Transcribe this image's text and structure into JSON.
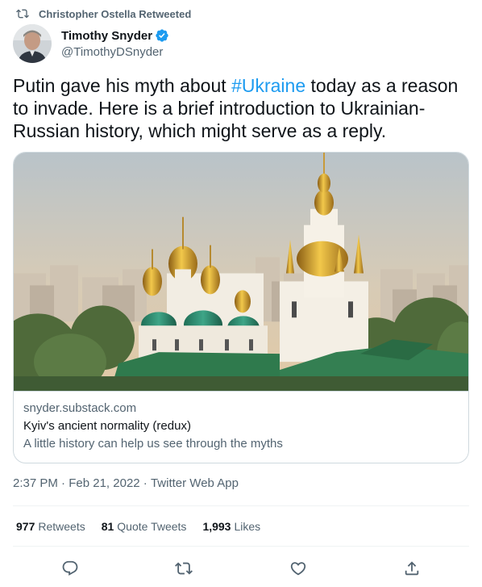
{
  "retweet": {
    "text": "Christopher Ostella Retweeted",
    "icon": "retweet-icon"
  },
  "author": {
    "name": "Timothy Snyder",
    "handle": "@TimothyDSnyder",
    "verified": true
  },
  "tweet": {
    "text_before": "Putin gave his myth about ",
    "hashtag": "#Ukraine",
    "text_after": " today as a reason to invade. Here is a brief introduction to Ukrainian-Russian history, which might serve as a reply."
  },
  "card": {
    "domain": "snyder.substack.com",
    "title": "Kyiv's ancient normality (redux)",
    "description": "A little history can help us see through the myths"
  },
  "timestamp": {
    "time": "2:37 PM",
    "date": "Feb 21, 2022",
    "source": "Twitter Web App",
    "separator": " · "
  },
  "stats": {
    "retweets": {
      "count": "977",
      "label": "Retweets"
    },
    "quote_tweets": {
      "count": "81",
      "label": "Quote Tweets"
    },
    "likes": {
      "count": "1,993",
      "label": "Likes"
    }
  },
  "actions": [
    "reply-icon",
    "retweet-icon",
    "like-icon",
    "share-icon"
  ],
  "colors": {
    "accent": "#1d9bf0",
    "text": "#0f1419",
    "secondary": "#536471",
    "border": "#cfd9de"
  }
}
